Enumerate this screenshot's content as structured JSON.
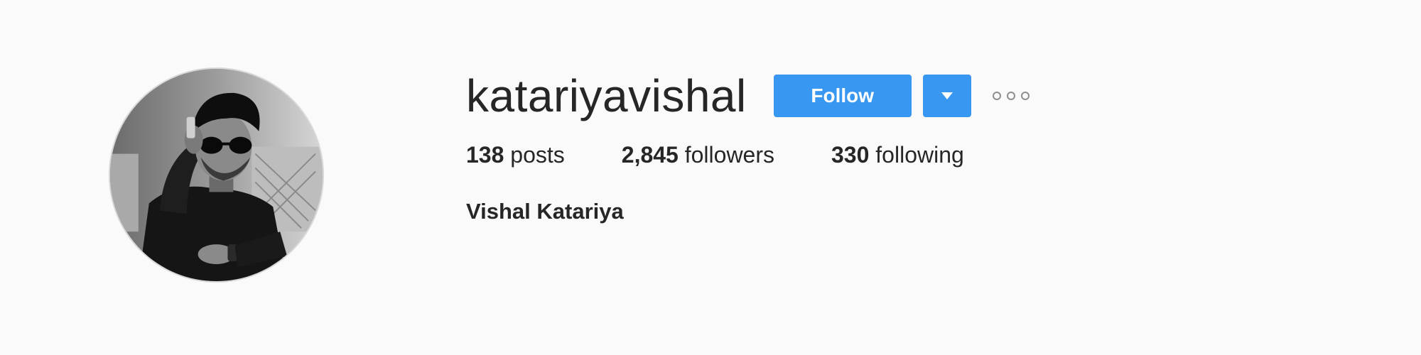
{
  "profile": {
    "username": "katariyavishal",
    "full_name": "Vishal Katariya",
    "follow_label": "Follow",
    "stats": {
      "posts_count": "138",
      "posts_label": "posts",
      "followers_count": "2,845",
      "followers_label": "followers",
      "following_count": "330",
      "following_label": "following"
    }
  },
  "icons": {
    "dropdown": "chevron-down-icon",
    "more": "more-options-icon"
  },
  "colors": {
    "accent": "#3897f0",
    "background": "#fafafa",
    "text": "#262626"
  }
}
